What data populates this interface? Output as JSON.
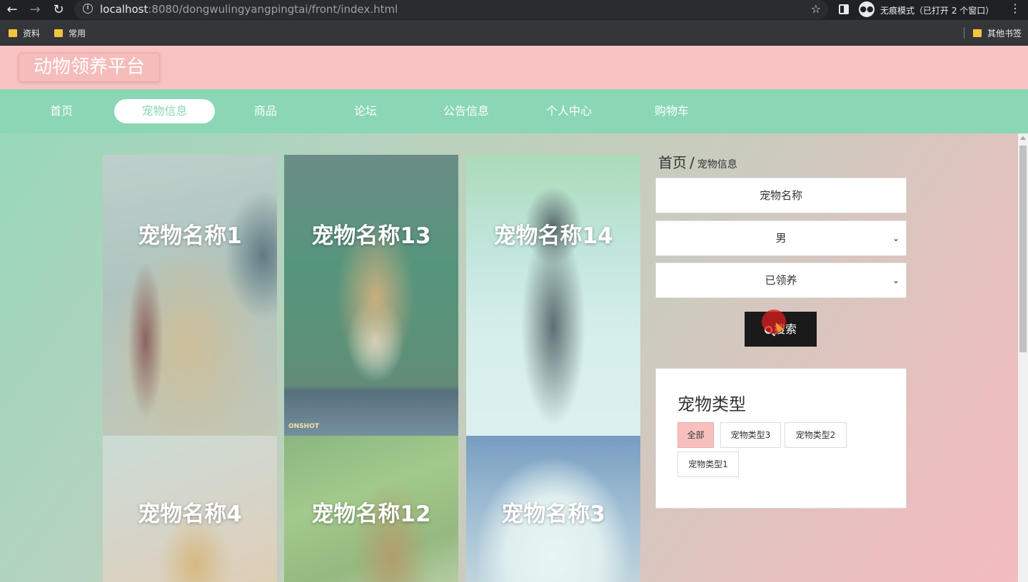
{
  "browser": {
    "url_host": "localhost",
    "url_rest": ":8080/dongwulingyangpingtai/front/index.html",
    "incognito_text": "无痕模式（已打开 2 个窗口）",
    "bookmarks": [
      "资料",
      "常用"
    ],
    "other_bookmarks": "其他书签"
  },
  "site": {
    "title": "动物领养平台"
  },
  "nav": {
    "items": [
      "首页",
      "宠物信息",
      "商品",
      "论坛",
      "公告信息",
      "个人中心",
      "购物车"
    ],
    "active": "宠物信息"
  },
  "colors": {
    "header": "#f7c2c1",
    "nav": "#8ad6b5",
    "accent_tag": "#f7c0bf",
    "search_button": "#1a1a1a"
  },
  "pets": [
    {
      "name": "宠物名称1"
    },
    {
      "name": "宠物名称13"
    },
    {
      "name": "宠物名称14"
    },
    {
      "name": "宠物名称4"
    },
    {
      "name": "宠物名称12"
    },
    {
      "name": "宠物名称3"
    }
  ],
  "card_watermark": "ONSHOT",
  "breadcrumb": {
    "home": "首页",
    "separator": "/",
    "current": "宠物信息"
  },
  "search": {
    "name_placeholder": "宠物名称",
    "gender_selected": "男",
    "status_selected": "已领养",
    "button_label": "搜索"
  },
  "categories": {
    "title": "宠物类型",
    "items": [
      "全部",
      "宠物类型3",
      "宠物类型2",
      "宠物类型1"
    ],
    "active": "全部"
  },
  "icons": {
    "back": "arrow-left-icon",
    "forward": "arrow-right-icon",
    "reload": "reload-icon",
    "info": "info-icon",
    "star": "star-icon",
    "search": "magnifier-icon"
  }
}
